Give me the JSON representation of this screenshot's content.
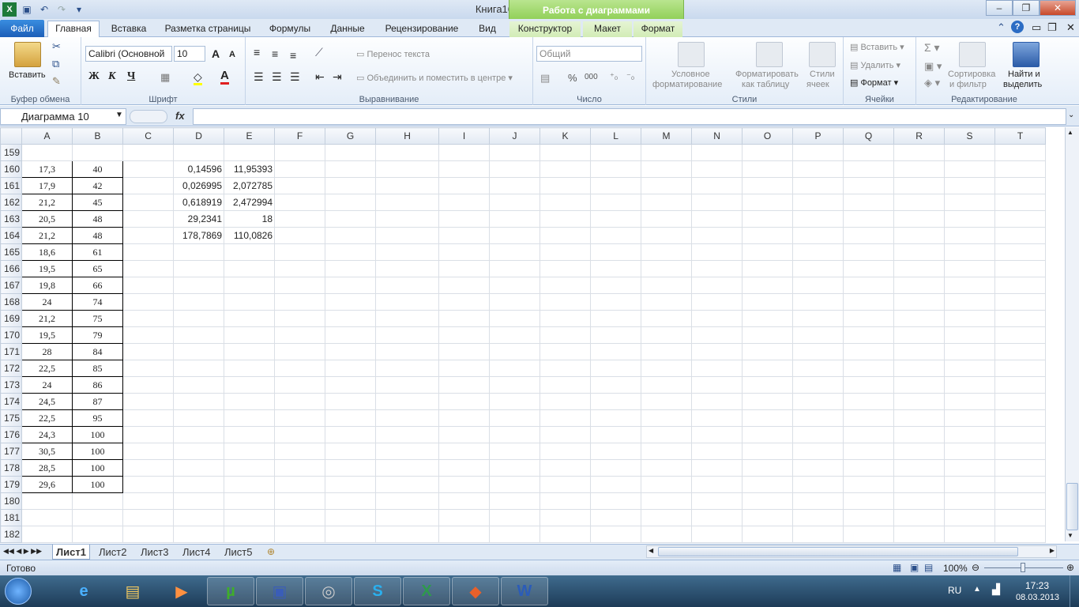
{
  "window": {
    "title": "Книга1666  -  Microsoft Excel",
    "context_tab_group": "Работа с диаграммами"
  },
  "tabs": [
    "Файл",
    "Главная",
    "Вставка",
    "Разметка страницы",
    "Формулы",
    "Данные",
    "Рецензирование",
    "Вид",
    "Конструктор",
    "Макет",
    "Формат"
  ],
  "ribbon": {
    "clipboard": {
      "label": "Буфер обмена",
      "paste": "Вставить"
    },
    "font": {
      "label": "Шрифт",
      "name": "Calibri (Основной",
      "size": "10",
      "bold": "Ж",
      "italic": "К",
      "underline": "Ч",
      "grow": "A",
      "shrink": "A"
    },
    "alignment": {
      "label": "Выравнивание",
      "wrap": "Перенос текста",
      "merge": "Объединить и поместить в центре"
    },
    "number": {
      "label": "Число",
      "format": "Общий",
      "percent": "%",
      "thousands": "000"
    },
    "styles": {
      "label": "Стили",
      "conditional_1": "Условное",
      "conditional_2": "форматирование",
      "format_table_1": "Форматировать",
      "format_table_2": "как таблицу",
      "cell_styles_1": "Стили",
      "cell_styles_2": "ячеек"
    },
    "cells": {
      "label": "Ячейки",
      "insert": "Вставить",
      "delete": "Удалить",
      "format": "Формат"
    },
    "editing": {
      "label": "Редактирование",
      "sort_1": "Сортировка",
      "sort_2": "и фильтр",
      "find_1": "Найти и",
      "find_2": "выделить"
    }
  },
  "formula_bar": {
    "name_box": "Диаграмма 10",
    "fx": "fx",
    "value": ""
  },
  "columns": [
    "A",
    "B",
    "C",
    "D",
    "E",
    "F",
    "G",
    "H",
    "I",
    "J",
    "K",
    "L",
    "M",
    "N",
    "O",
    "P",
    "Q",
    "R",
    "S",
    "T"
  ],
  "rows": [
    {
      "n": "159",
      "a": "",
      "b": "",
      "d": "",
      "e": ""
    },
    {
      "n": "160",
      "a": "17,3",
      "b": "40",
      "d": "0,14596",
      "e": "11,95393"
    },
    {
      "n": "161",
      "a": "17,9",
      "b": "42",
      "d": "0,026995",
      "e": "2,072785"
    },
    {
      "n": "162",
      "a": "21,2",
      "b": "45",
      "d": "0,618919",
      "e": "2,472994"
    },
    {
      "n": "163",
      "a": "20,5",
      "b": "48",
      "d": "29,2341",
      "e": "18"
    },
    {
      "n": "164",
      "a": "21,2",
      "b": "48",
      "d": "178,7869",
      "e": "110,0826"
    },
    {
      "n": "165",
      "a": "18,6",
      "b": "61",
      "d": "",
      "e": ""
    },
    {
      "n": "166",
      "a": "19,5",
      "b": "65",
      "d": "",
      "e": ""
    },
    {
      "n": "167",
      "a": "19,8",
      "b": "66",
      "d": "",
      "e": ""
    },
    {
      "n": "168",
      "a": "24",
      "b": "74",
      "d": "",
      "e": ""
    },
    {
      "n": "169",
      "a": "21,2",
      "b": "75",
      "d": "",
      "e": ""
    },
    {
      "n": "170",
      "a": "19,5",
      "b": "79",
      "d": "",
      "e": ""
    },
    {
      "n": "171",
      "a": "28",
      "b": "84",
      "d": "",
      "e": ""
    },
    {
      "n": "172",
      "a": "22,5",
      "b": "85",
      "d": "",
      "e": ""
    },
    {
      "n": "173",
      "a": "24",
      "b": "86",
      "d": "",
      "e": ""
    },
    {
      "n": "174",
      "a": "24,5",
      "b": "87",
      "d": "",
      "e": ""
    },
    {
      "n": "175",
      "a": "22,5",
      "b": "95",
      "d": "",
      "e": ""
    },
    {
      "n": "176",
      "a": "24,3",
      "b": "100",
      "d": "",
      "e": ""
    },
    {
      "n": "177",
      "a": "30,5",
      "b": "100",
      "d": "",
      "e": ""
    },
    {
      "n": "178",
      "a": "28,5",
      "b": "100",
      "d": "",
      "e": ""
    },
    {
      "n": "179",
      "a": "29,6",
      "b": "100",
      "d": "",
      "e": ""
    },
    {
      "n": "180",
      "a": "",
      "b": "",
      "d": "",
      "e": ""
    },
    {
      "n": "181",
      "a": "",
      "b": "",
      "d": "",
      "e": ""
    },
    {
      "n": "182",
      "a": "",
      "b": "",
      "d": "",
      "e": ""
    }
  ],
  "sheets": [
    "Лист1",
    "Лист2",
    "Лист3",
    "Лист4",
    "Лист5"
  ],
  "status": {
    "ready": "Готово",
    "zoom": "100%"
  },
  "taskbar": {
    "lang": "RU",
    "time": "17:23",
    "date": "08.03.2013"
  },
  "colors": {
    "file_tab": "#1c5fb8",
    "chart_tools": "#8fcf55",
    "taskbar": "#1d3b57"
  }
}
